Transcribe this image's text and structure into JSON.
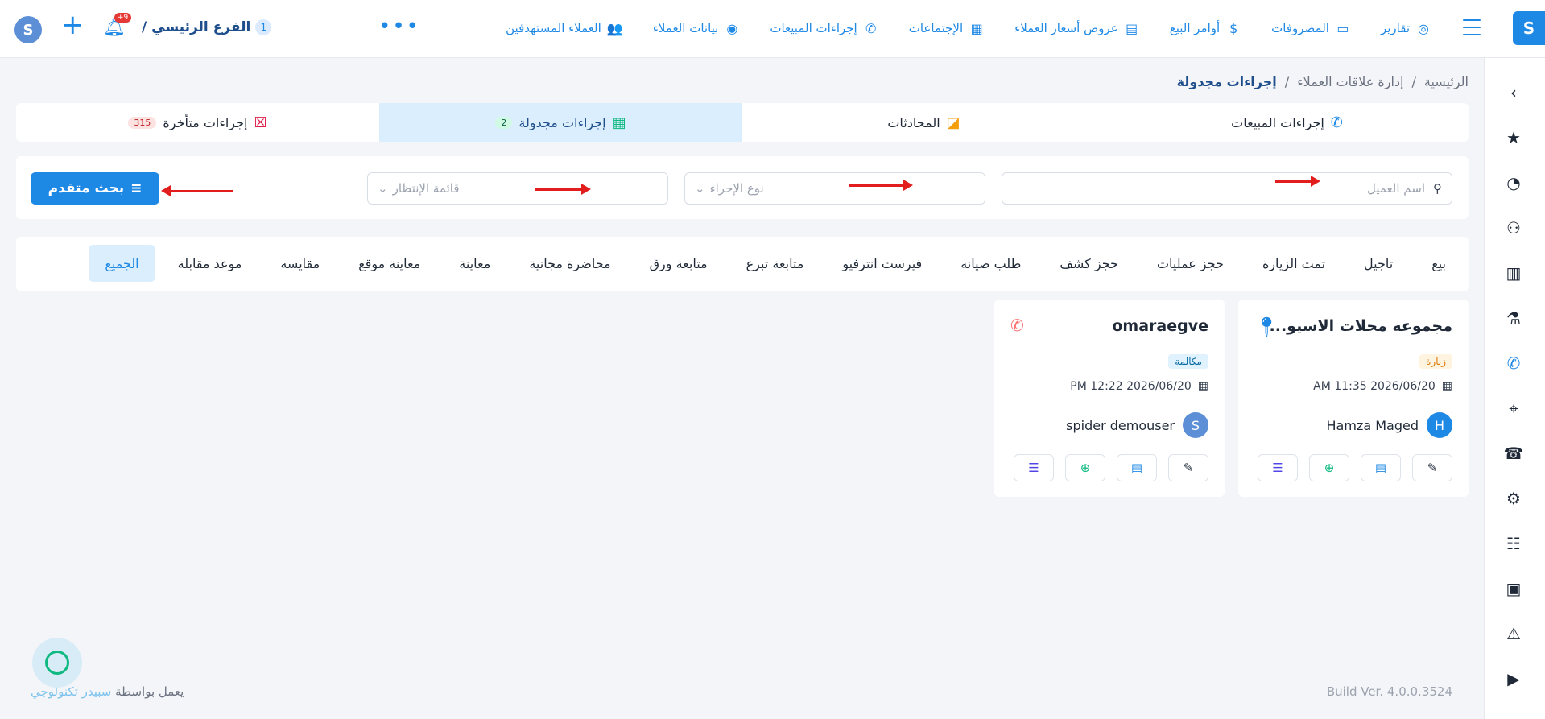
{
  "topbar": {
    "nav_items": [
      {
        "label": "العملاء المستهدفين",
        "icon": "target-customers-icon"
      },
      {
        "label": "بيانات العملاء",
        "icon": "customer-data-icon"
      },
      {
        "label": "إجراءات المبيعات",
        "icon": "phone-icon"
      },
      {
        "label": "الإجتماعات",
        "icon": "meeting-icon"
      },
      {
        "label": "عروض أسعار العملاء",
        "icon": "quote-icon"
      },
      {
        "label": "أوامر البيع",
        "icon": "money-bag-icon"
      },
      {
        "label": "المصروفات",
        "icon": "laptop-icon"
      },
      {
        "label": "تقارير",
        "icon": "reports-icon"
      }
    ],
    "more_label": "•••",
    "branch_name": "الفرع الرئيسي /",
    "branch_count": "1",
    "notif_badge": "+9",
    "plus_label": "+"
  },
  "breadcrumb": {
    "home": "الرئيسية",
    "sep1": "/",
    "section": "إدارة علاقات العملاء",
    "sep2": "/",
    "current": "إجراءات مجدولة"
  },
  "tabs": [
    {
      "label": "إجراءات المبيعات",
      "icon": "phone-icon",
      "count": ""
    },
    {
      "label": "المحادثات",
      "icon": "chat-icon",
      "count": ""
    },
    {
      "label": "إجراءات مجدولة",
      "icon": "calendar-icon",
      "count": "2"
    },
    {
      "label": "إجراءات متأخرة",
      "icon": "calendar-x-icon",
      "count": "315"
    }
  ],
  "filters": {
    "customer_placeholder": "اسم العميل",
    "action_type_placeholder": "نوع الإجراء",
    "waitlist_placeholder": "قائمة الإنتظار",
    "advanced_search_label": "بحث متقدم"
  },
  "chips": [
    "الجميع",
    "موعد مقابلة",
    "مقايسه",
    "معاينة موقع",
    "معاينة",
    "محاضرة مجانية",
    "متابعة ورق",
    "متابعة تبرع",
    "فيرست انترفيو",
    "طلب صيانه",
    "حجز كشف",
    "حجز عمليات",
    "تمت الزيارة",
    "تاجيل",
    "بيع"
  ],
  "cards": [
    {
      "title": "مجموعه محلات الاسيو...",
      "type": "زيارة",
      "date": "2026/06/20 11:35 AM",
      "person": "Hamza Maged",
      "avatar": "H"
    },
    {
      "title": "omaraegve",
      "type": "مكالمة",
      "date": "2026/06/20 12:22 PM",
      "person": "spider demouser",
      "avatar": ""
    }
  ],
  "footer": {
    "version": "Build Ver. 4.0.0.3524",
    "powered_prefix": "يعمل بواسطة",
    "powered_brand": "سبيدر تكنولوجي"
  },
  "colors": {
    "accent": "#1e88e5",
    "active_tab_bg": "#dbeefd",
    "arrow": "#e11d1d"
  }
}
